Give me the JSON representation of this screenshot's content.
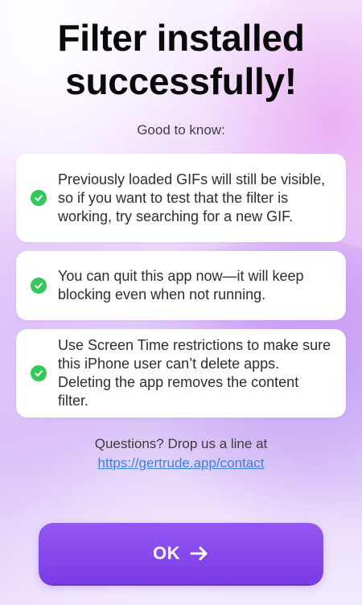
{
  "title": "Filter installed successfully!",
  "subtitle": "Good to know:",
  "tips": [
    {
      "text": "Previously loaded GIFs will still be visible, so if you want to test that the filter is working, try searching for a new GIF.",
      "icon": "check-circle-icon"
    },
    {
      "text": "You can quit this app now—it will keep blocking even when not running.",
      "icon": "check-circle-icon"
    },
    {
      "text": "Use Screen Time restrictions to make sure this iPhone user can’t delete apps. Deleting the app removes the content filter.",
      "icon": "check-circle-icon"
    }
  ],
  "contact": {
    "prompt": "Questions? Drop us a line at",
    "link": "https://gertrude.app/contact"
  },
  "ok_button": {
    "label": "OK",
    "icon": "arrow-right-icon"
  },
  "colors": {
    "accent": "#8a4cf0",
    "check": "#34c759",
    "link": "#3a82e6"
  }
}
